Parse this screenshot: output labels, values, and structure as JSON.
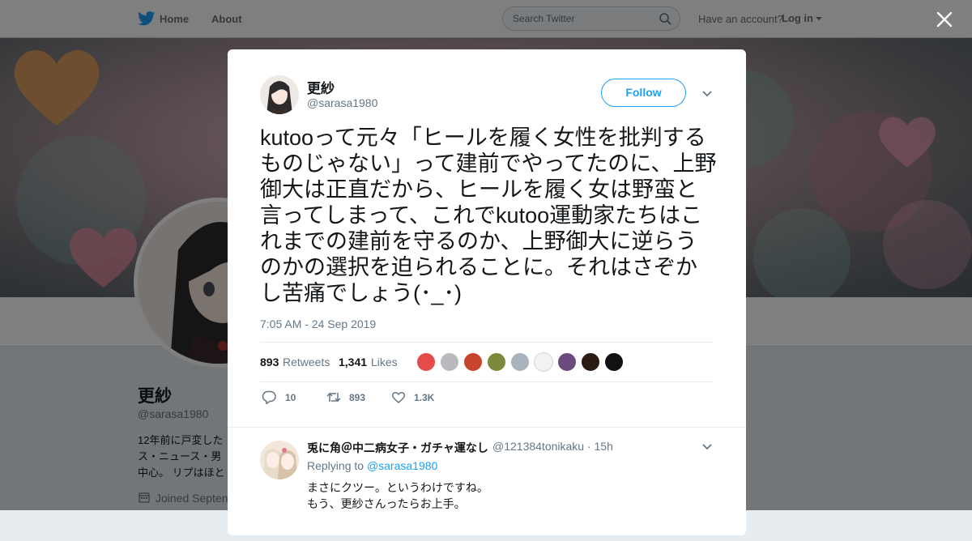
{
  "nav": {
    "home_label": "Home",
    "about_label": "About",
    "search_placeholder": "Search Twitter",
    "have_account": "Have an account?",
    "login_label": "Log in"
  },
  "profile": {
    "name": "更紗",
    "handle": "@sarasa1980",
    "bio": "12年前に戸変した\nス・ニュース・男\n中心。 リプはほと",
    "joined": "Joined Septen"
  },
  "tweet": {
    "author_name": "更紗",
    "author_handle": "@sarasa1980",
    "follow_label": "Follow",
    "text": "kutooって元々「ヒールを履く女性を批判するものじゃない」って建前でやってたのに、上野御大は正直だから、ヒールを履く女は野蛮と言ってしまって、これでkutoo運動家たちはこれまでの建前を守るのか、上野御大に逆らうのかの選択を迫られることに。それはさぞかし苦痛でしょう(･_･)",
    "timestamp": "7:05 AM - 24 Sep 2019",
    "retweets_count": "893",
    "retweets_label": "Retweets",
    "likes_count": "1,341",
    "likes_label": "Likes",
    "actions": {
      "reply_count": "10",
      "retweet_count": "893",
      "like_count": "1.3K"
    },
    "liker_colors": [
      "#e44b4b",
      "#b9b9be",
      "#c8452d",
      "#7b8a3a",
      "#aab3bd",
      "#f2f2f2",
      "#6b4a7d",
      "#2a1b14",
      "#111111"
    ]
  },
  "reply": {
    "name": "兎に角＠中二病女子・ガチャ運なし",
    "handle_time": "@121384tonikaku · 15h",
    "replying_prefix": "Replying to",
    "replying_to": "@sarasa1980",
    "line1": "まさにクツー。というわけですね。",
    "line2": "もう、更紗さんったらお上手。"
  },
  "colors": {
    "accent": "#1da1f2",
    "text": "#14171a",
    "muted": "#657786"
  }
}
